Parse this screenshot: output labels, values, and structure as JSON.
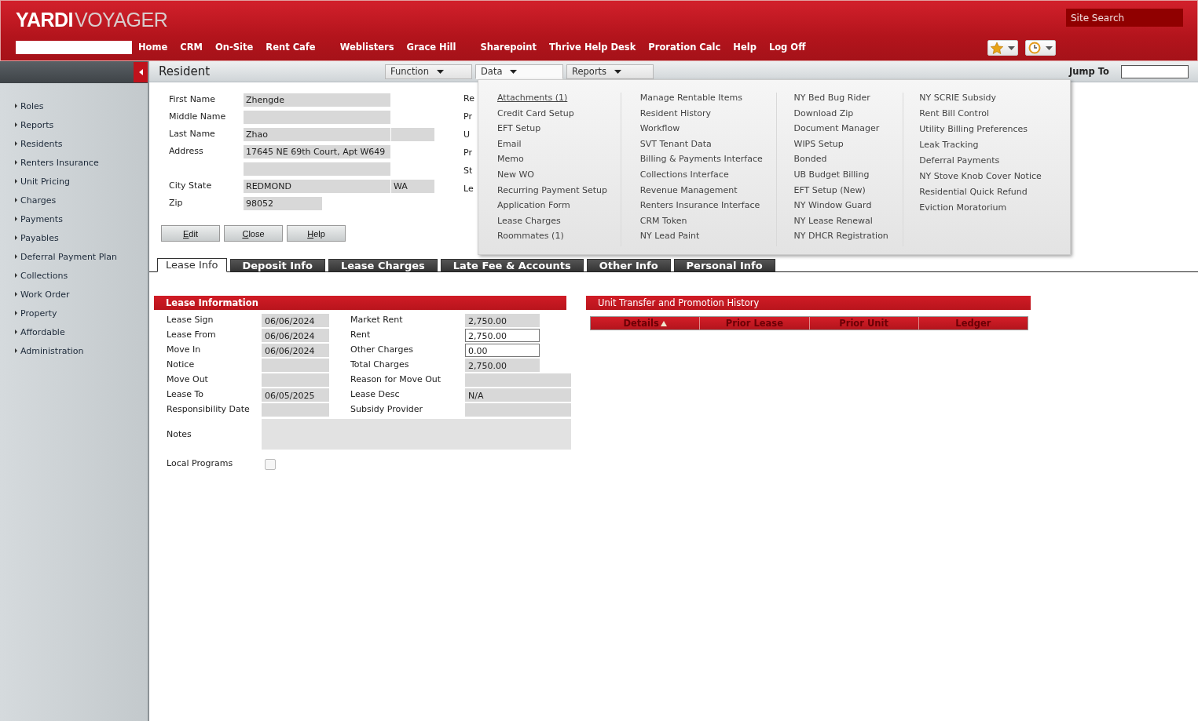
{
  "header": {
    "logo": {
      "primary": "YARDI",
      "secondary": "VOYAGER"
    },
    "nav": [
      "Home",
      "CRM",
      "On-Site",
      "Rent Cafe",
      "Weblisters",
      "Grace Hill",
      "Sharepoint",
      "Thrive Help Desk",
      "Proration Calc",
      "Help",
      "Log Off"
    ],
    "site_search": {
      "placeholder": "Site Search"
    }
  },
  "sidebar": {
    "items": [
      "Roles",
      "Reports",
      "Residents",
      "Renters Insurance",
      "Unit Pricing",
      "Charges",
      "Payments",
      "Payables",
      "Deferral Payment Plan",
      "Collections",
      "Work Order",
      "Property",
      "Affordable",
      "Administration"
    ]
  },
  "toolbar": {
    "title": "Resident",
    "menus": [
      {
        "label": "Function",
        "selected": false
      },
      {
        "label": "Data",
        "selected": true
      },
      {
        "label": "Reports",
        "selected": false
      }
    ],
    "jump_to": {
      "label": "Jump To"
    }
  },
  "resident": {
    "fields": [
      {
        "label": "First Name",
        "value": "Zhengde",
        "kind": "wide"
      },
      {
        "label": "Middle Name",
        "kind": "wide"
      },
      {
        "label": "Last Name",
        "value": "Zhao",
        "kind": "split"
      },
      {
        "label": "Address",
        "value": "17645 NE 69th Court, Apt W649",
        "kind": "wide"
      },
      {
        "kind": "wide"
      },
      {
        "label": "City State",
        "value": "REDMOND",
        "extra": "WA",
        "kind": "split"
      },
      {
        "label": "Zip",
        "value": "98052",
        "kind": "short"
      }
    ],
    "side_labels": [
      "Re",
      "Pr",
      "U",
      "Pr",
      "St",
      "Le"
    ],
    "buttons": [
      "Edit",
      "Close",
      "Help"
    ]
  },
  "tabs": [
    {
      "label": "Lease Info",
      "selected": true
    },
    {
      "label": "Deposit Info",
      "selected": false
    },
    {
      "label": "Lease Charges",
      "selected": false
    },
    {
      "label": "Late Fee & Accounts",
      "selected": false
    },
    {
      "label": "Other Info",
      "selected": false
    },
    {
      "label": "Personal Info",
      "selected": false
    }
  ],
  "lease_information": {
    "title": "Lease Information",
    "left": [
      {
        "label": "Lease Sign",
        "value": "06/06/2024"
      },
      {
        "label": "Lease From",
        "value": "06/06/2024"
      },
      {
        "label": "Move In",
        "value": "06/06/2024"
      },
      {
        "label": "Notice"
      },
      {
        "label": "Move Out"
      },
      {
        "label": "Lease To",
        "value": "06/05/2025"
      },
      {
        "label": "Responsibility Date"
      }
    ],
    "right": [
      {
        "label": "Market Rent",
        "value": "2,750.00",
        "editable": false,
        "kind": "short"
      },
      {
        "label": "Rent",
        "value": "2,750.00",
        "editable": true,
        "kind": "short"
      },
      {
        "label": "Other Charges",
        "value": "0.00",
        "editable": true,
        "kind": "short"
      },
      {
        "label": "Total Charges",
        "value": "2,750.00",
        "editable": false,
        "kind": "short"
      },
      {
        "label": "Reason for Move Out",
        "editable": false,
        "kind": "wide"
      },
      {
        "label": "Lease Desc",
        "value": "N/A",
        "editable": false,
        "kind": "wide"
      },
      {
        "label": "Subsidy Provider",
        "editable": false,
        "kind": "wide"
      }
    ],
    "notes": {
      "label": "Notes"
    },
    "local_programs": {
      "label": "Local Programs",
      "checked": false
    }
  },
  "unit_transfer": {
    "title": "Unit Transfer and Promotion History",
    "columns": [
      {
        "label": "Details",
        "sorted": true
      },
      {
        "label": "Prior Lease",
        "sorted": false
      },
      {
        "label": "Prior Unit",
        "sorted": false
      },
      {
        "label": "Ledger",
        "sorted": false
      }
    ]
  },
  "data_menu": {
    "columns": [
      [
        {
          "label": "Attachments (1)",
          "hovered": true
        },
        {
          "label": "Credit Card Setup",
          "hovered": false
        },
        {
          "label": "EFT Setup",
          "hovered": false
        },
        {
          "label": "Email",
          "hovered": false
        },
        {
          "label": "Memo",
          "hovered": false
        },
        {
          "label": "New WO",
          "hovered": false
        },
        {
          "label": "Recurring Payment Setup",
          "hovered": false
        },
        {
          "label": "Application Form",
          "hovered": false
        },
        {
          "label": "Lease Charges",
          "hovered": false
        },
        {
          "label": "Roommates (1)",
          "hovered": false
        }
      ],
      [
        {
          "label": "Manage Rentable Items",
          "hovered": false
        },
        {
          "label": "Resident History",
          "hovered": false
        },
        {
          "label": "Workflow",
          "hovered": false
        },
        {
          "label": "SVT Tenant Data",
          "hovered": false
        },
        {
          "label": "Billing & Payments Interface",
          "hovered": false
        },
        {
          "label": "Collections Interface",
          "hovered": false
        },
        {
          "label": "Revenue Management",
          "hovered": false
        },
        {
          "label": "Renters Insurance Interface",
          "hovered": false
        },
        {
          "label": "CRM Token",
          "hovered": false
        },
        {
          "label": "NY Lead Paint",
          "hovered": false
        }
      ],
      [
        {
          "label": "NY Bed Bug Rider",
          "hovered": false
        },
        {
          "label": "Download Zip",
          "hovered": false
        },
        {
          "label": "Document Manager",
          "hovered": false
        },
        {
          "label": "WIPS Setup",
          "hovered": false
        },
        {
          "label": "Bonded",
          "hovered": false
        },
        {
          "label": "UB Budget Billing",
          "hovered": false
        },
        {
          "label": "EFT Setup (New)",
          "hovered": false
        },
        {
          "label": "NY Window Guard",
          "hovered": false
        },
        {
          "label": "NY Lease Renewal",
          "hovered": false
        },
        {
          "label": "NY DHCR Registration",
          "hovered": false
        }
      ],
      [
        {
          "label": "NY SCRIE Subsidy",
          "hovered": false
        },
        {
          "label": "Rent Bill Control",
          "hovered": false
        },
        {
          "label": "Utility Billing Preferences",
          "hovered": false
        },
        {
          "label": "Leak Tracking",
          "hovered": false
        },
        {
          "label": "Deferral Payments",
          "hovered": false
        },
        {
          "label": "NY Stove Knob Cover Notice",
          "hovered": false
        },
        {
          "label": "Residential Quick Refund",
          "hovered": false
        },
        {
          "label": "Eviction Moratorium",
          "hovered": false
        }
      ]
    ]
  }
}
